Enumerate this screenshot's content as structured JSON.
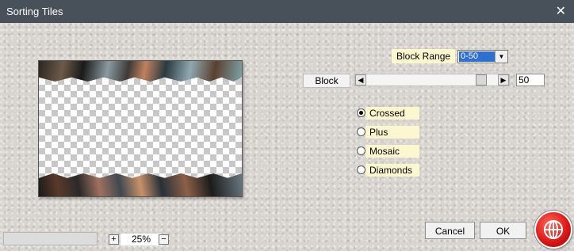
{
  "window": {
    "title": "Sorting Tiles",
    "close_glyph": "✕"
  },
  "controls": {
    "block_range_label": "Block Range",
    "block_range_value": "0-50",
    "block_label": "Block",
    "block_slider_value": 50,
    "block_slider_max": 50,
    "block_value": "50"
  },
  "radio_options": [
    {
      "label": "Crossed",
      "selected": true
    },
    {
      "label": "Plus",
      "selected": false
    },
    {
      "label": "Mosaic",
      "selected": false
    },
    {
      "label": "Diamonds",
      "selected": false
    }
  ],
  "buttons": {
    "cancel": "Cancel",
    "ok": "OK"
  },
  "zoom": {
    "plus": "+",
    "minus": "−",
    "level": "25%"
  },
  "icons": {
    "logo": "flaming-pear-logo-icon",
    "dropdown": "chevron-down-icon",
    "slider_left": "triangle-left-icon",
    "slider_right": "triangle-right-icon"
  },
  "colors": {
    "titlebar": "#485159",
    "label_bg": "#fdf7cf",
    "selection": "#2f6fd1",
    "logo_red": "#e01818"
  }
}
